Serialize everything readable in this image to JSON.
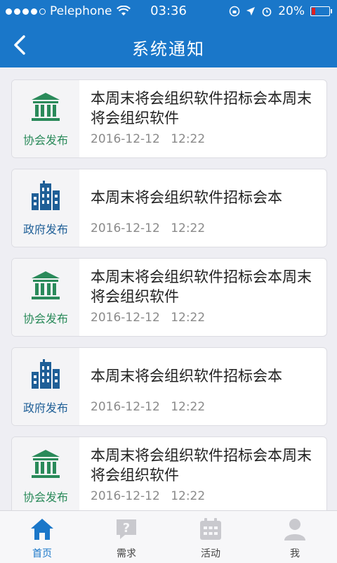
{
  "status": {
    "carrier": "Pelephone",
    "time": "03:36",
    "battery": "20%",
    "battery_level": 0.2
  },
  "nav": {
    "title": "系统通知"
  },
  "colors": {
    "primary": "#1a77c9",
    "association_green": "#2a8a5a",
    "government_blue": "#1f5f97"
  },
  "notices": [
    {
      "type": "association",
      "icon": "bank-building-icon",
      "tag": "协会发布",
      "text": "本周末将会组织软件招标会本周末将会组织软件",
      "date": "2016-12-12 12:22"
    },
    {
      "type": "government",
      "icon": "city-buildings-icon",
      "tag": "政府发布",
      "text": "本周末将会组织软件招标会本",
      "date": "2016-12-12 12:22"
    },
    {
      "type": "association",
      "icon": "bank-building-icon",
      "tag": "协会发布",
      "text": "本周末将会组织软件招标会本周末将会组织软件",
      "date": "2016-12-12 12:22"
    },
    {
      "type": "government",
      "icon": "city-buildings-icon",
      "tag": "政府发布",
      "text": "本周末将会组织软件招标会本",
      "date": "2016-12-12 12:22"
    },
    {
      "type": "association",
      "icon": "bank-building-icon",
      "tag": "协会发布",
      "text": "本周末将会组织软件招标会本周末将会组织软件",
      "date": "2016-12-12 12:22"
    }
  ],
  "tabs": [
    {
      "label": "首页",
      "icon": "home-icon",
      "active": true
    },
    {
      "label": "需求",
      "icon": "question-bubble-icon",
      "active": false
    },
    {
      "label": "活动",
      "icon": "calendar-icon",
      "active": false
    },
    {
      "label": "我",
      "icon": "user-icon",
      "active": false
    }
  ]
}
